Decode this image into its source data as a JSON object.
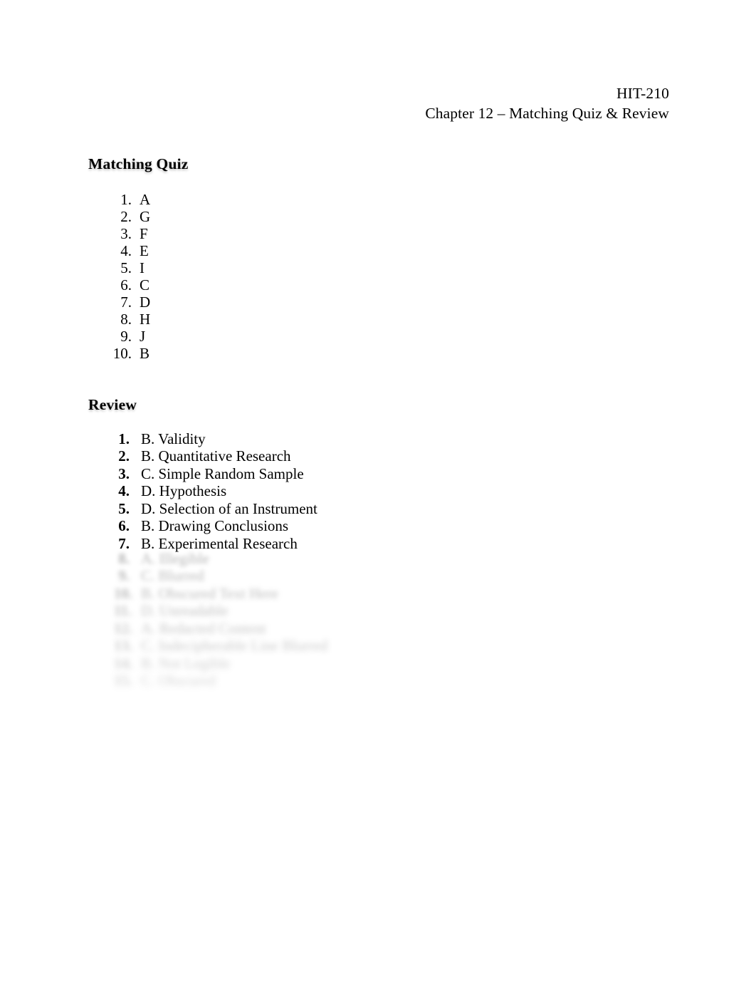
{
  "document": {
    "header": {
      "course_code": "HIT-210",
      "subtitle": "Chapter 12 – Matching Quiz & Review"
    },
    "sections": [
      {
        "heading": "Matching Quiz",
        "items": [
          {
            "number": "1.",
            "answer": "A"
          },
          {
            "number": "2.",
            "answer": "G"
          },
          {
            "number": "3.",
            "answer": "F"
          },
          {
            "number": "4.",
            "answer": "E"
          },
          {
            "number": "5.",
            "answer": "I"
          },
          {
            "number": "6.",
            "answer": "C"
          },
          {
            "number": "7.",
            "answer": "D"
          },
          {
            "number": "8.",
            "answer": "H"
          },
          {
            "number": "9.",
            "answer": "J"
          },
          {
            "number": "10.",
            "answer": "B"
          }
        ]
      },
      {
        "heading": "Review",
        "items": [
          {
            "number": "1.",
            "answer": "B. Validity"
          },
          {
            "number": "2.",
            "answer": "B. Quantitative Research"
          },
          {
            "number": "3.",
            "answer": "C. Simple Random Sample"
          },
          {
            "number": "4.",
            "answer": "D. Hypothesis"
          },
          {
            "number": "5.",
            "answer": "D. Selection of an Instrument"
          },
          {
            "number": "6.",
            "answer": "B. Drawing Conclusions"
          },
          {
            "number": "7.",
            "answer": "B. Experimental Research"
          }
        ],
        "obscured_items": [
          {
            "number": "8.",
            "answer": "A. Illegible"
          },
          {
            "number": "9.",
            "answer": "C. Blurred"
          },
          {
            "number": "10.",
            "answer": "B. Obscured Text Here"
          },
          {
            "number": "11.",
            "answer": "D. Unreadable"
          },
          {
            "number": "12.",
            "answer": "A. Redacted Content"
          },
          {
            "number": "13.",
            "answer": "C. Indecipherable Line Blurred"
          },
          {
            "number": "14.",
            "answer": "B. Not Legible"
          },
          {
            "number": "15.",
            "answer": "C. Obscured"
          }
        ]
      }
    ]
  }
}
